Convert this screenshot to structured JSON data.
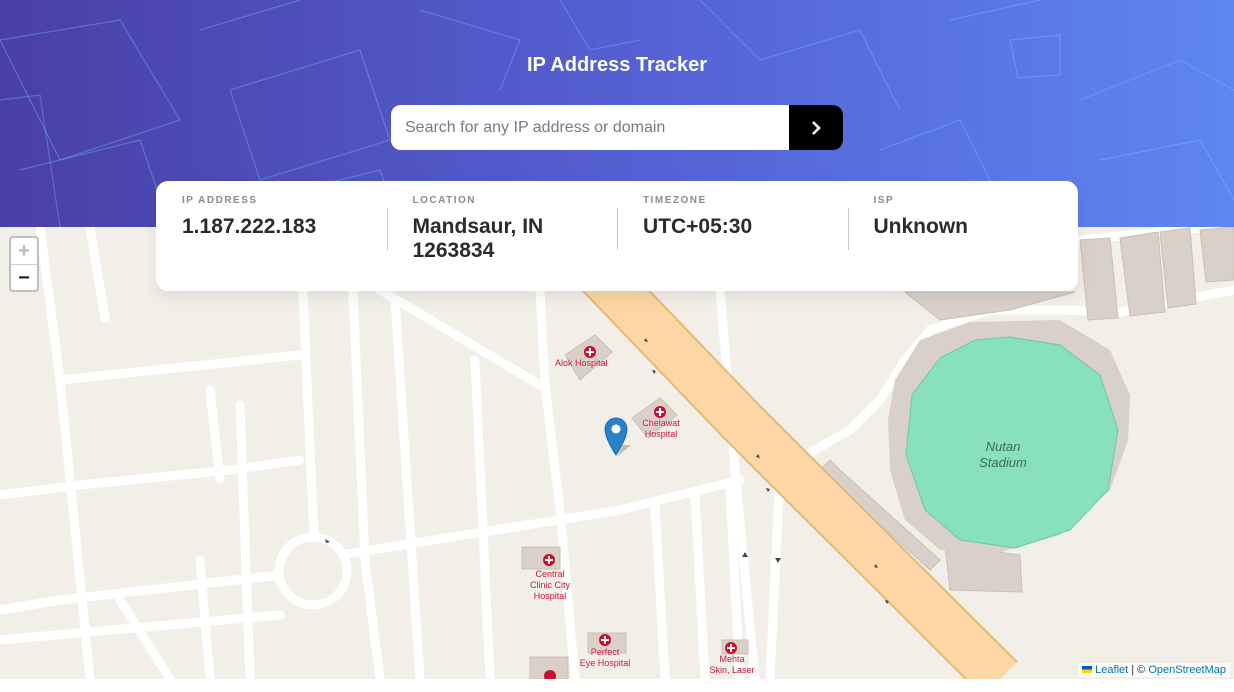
{
  "header": {
    "title": "IP Address Tracker"
  },
  "search": {
    "placeholder": "Search for any IP address or domain",
    "button_icon": "chevron-right-icon"
  },
  "info": {
    "ip_label": "IP ADDRESS",
    "ip_value": "1.187.222.183",
    "location_label": "LOCATION",
    "location_value": "Mandsaur, IN 1263834",
    "timezone_label": "TIMEZONE",
    "timezone_value": "UTC+05:30",
    "isp_label": "ISP",
    "isp_value": "Unknown"
  },
  "map": {
    "zoom_in": "+",
    "zoom_out": "−",
    "poi": {
      "alok": "Alok Hospital",
      "chelawat_1": "Chelawat",
      "chelawat_2": "Hospital",
      "stadium_1": "Nutan",
      "stadium_2": "Stadium",
      "central_1": "Central",
      "central_2": "Clinic City",
      "central_3": "Hospital",
      "perfect_1": "Perfect",
      "perfect_2": "Eye Hospital",
      "mehta_1": "Mehta",
      "mehta_2": "Skin, Laser"
    },
    "attribution": {
      "leaflet": "Leaflet",
      "separator": " | © ",
      "osm": "OpenStreetMap"
    }
  },
  "colors": {
    "header_start": "#4a3fa6",
    "header_end": "#5f86f0",
    "marker": "#2a81cb",
    "hospital": "#c8102e",
    "stadium": "#88e0be",
    "road_major": "#fcd6a4"
  }
}
